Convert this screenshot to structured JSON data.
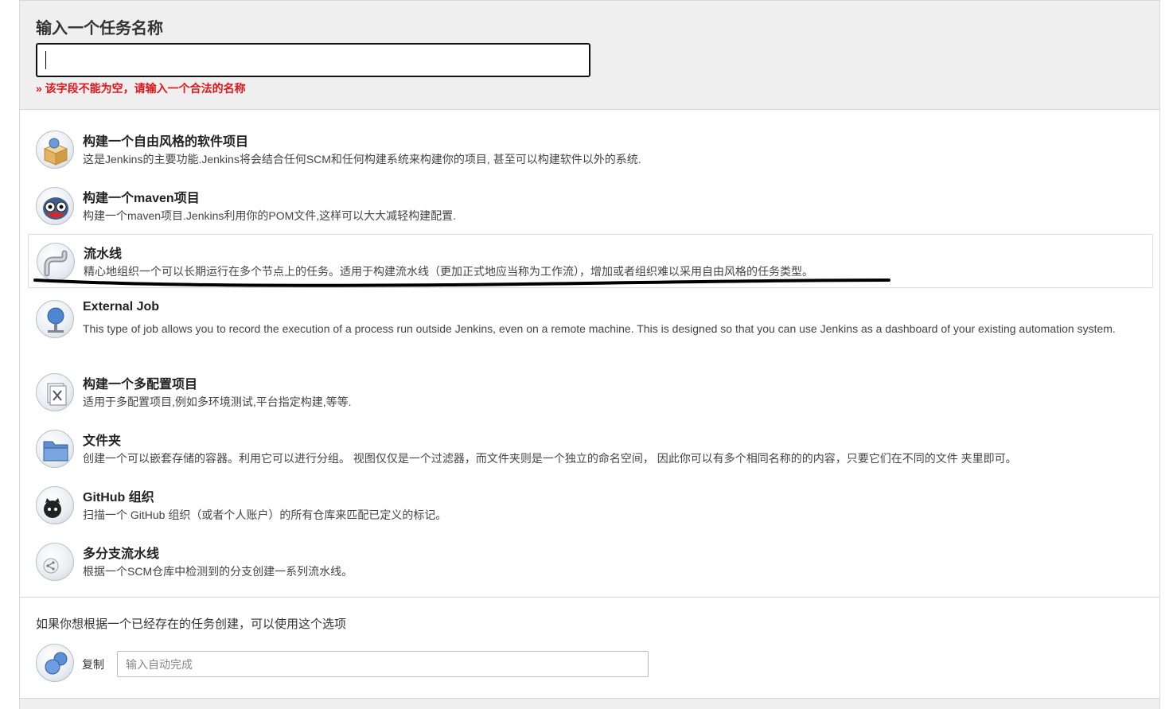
{
  "header": {
    "title": "输入一个任务名称",
    "name_input_value": "",
    "error": "» 该字段不能为空，请输入一个合法的名称"
  },
  "items": [
    {
      "title": "构建一个自由风格的软件项目",
      "desc": "这是Jenkins的主要功能.Jenkins将会结合任何SCM和任何构建系统来构建你的项目, 甚至可以构建软件以外的系统.",
      "icon": "package-box-icon"
    },
    {
      "title": "构建一个maven项目",
      "desc": "构建一个maven项目.Jenkins利用你的POM文件,这样可以大大减轻构建配置.",
      "icon": "maven-owl-icon"
    },
    {
      "title": "流水线",
      "desc": "精心地组织一个可以长期运行在多个节点上的任务。适用于构建流水线（更加正式地应当称为工作流），增加或者组织难以采用自由风格的任务类型。",
      "icon": "pipe-icon",
      "selected": true
    },
    {
      "title": "External Job",
      "desc": "This type of job allows you to record the execution of a process run outside Jenkins, even on a remote machine. This is designed so that you can use Jenkins as a dashboard of your existing automation system.",
      "icon": "monitor-globe-icon"
    },
    {
      "title": "构建一个多配置项目",
      "desc": "适用于多配置项目,例如多环境测试,平台指定构建,等等.",
      "icon": "config-tools-icon"
    },
    {
      "title": "文件夹",
      "desc": "创建一个可以嵌套存储的容器。利用它可以进行分组。 视图仅仅是一个过滤器，而文件夹则是一个独立的命名空间， 因此你可以有多个相同名称的的内容，只要它们在不同的文件 夹里即可。",
      "icon": "folder-icon"
    },
    {
      "title": "GitHub 组织",
      "desc": "扫描一个 GitHub 组织（或者个人账户）的所有仓库来匹配已定义的标记。",
      "icon": "github-octocat-icon"
    },
    {
      "title": "多分支流水线",
      "desc": "根据一个SCM仓库中检测到的分支创建一系列流水线。",
      "icon": "branch-icon"
    }
  ],
  "copy": {
    "hint": "如果你想根据一个已经存在的任务创建，可以使用这个选项",
    "label": "复制",
    "placeholder": "输入自动完成"
  },
  "colors": {
    "error": "#e0161b",
    "header_bg": "#efefef",
    "annotation": "#000000"
  }
}
